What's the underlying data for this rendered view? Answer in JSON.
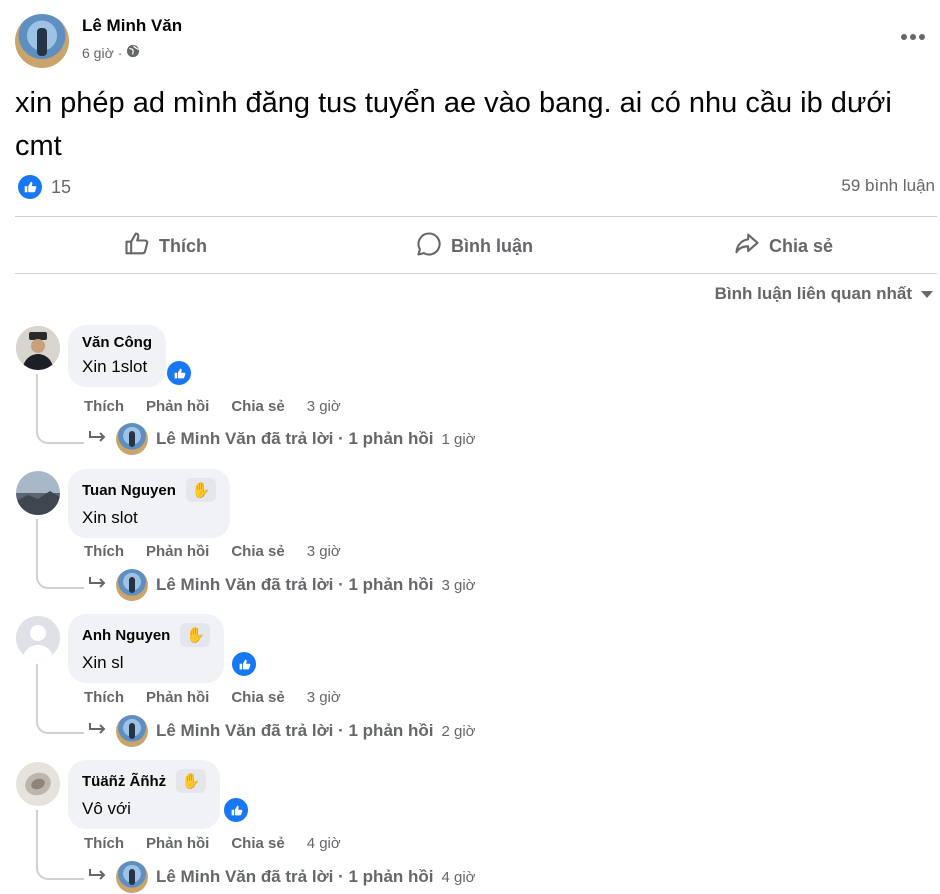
{
  "post": {
    "author": "Lê Minh Văn",
    "time": "6 giờ",
    "text": "xin phép ad mình đăng tus tuyển ae vào bang. ai có nhu cầu ib dưới cmt",
    "reaction_count": "15",
    "comment_count": "59 bình luận"
  },
  "actions": {
    "like": "Thích",
    "comment": "Bình luận",
    "share": "Chia sẻ"
  },
  "sort_label": "Bình luận liên quan nhất",
  "comment_actions": {
    "like": "Thích",
    "reply": "Phản hồi",
    "share": "Chia sẻ"
  },
  "comments": [
    {
      "name": "Văn Công",
      "text": "Xin 1slot",
      "time": "3 giờ",
      "reply_by": "Lê Minh Văn đã trả lời · 1 phản hồi",
      "reply_time": "1 giờ"
    },
    {
      "name": "Tuan Nguyen",
      "text": "Xin slot",
      "time": "3 giờ",
      "reply_by": "Lê Minh Văn đã trả lời · 1 phản hồi",
      "reply_time": "3 giờ"
    },
    {
      "name": "Anh Nguyen",
      "text": "Xin sl",
      "time": "3 giờ",
      "reply_by": "Lê Minh Văn đã trả lời · 1 phản hồi",
      "reply_time": "2 giờ"
    },
    {
      "name": "Tüäñż Ãñhż",
      "text": "Vô với",
      "time": "4 giờ",
      "reply_by": "Lê Minh Văn đã trả lời · 1 phản hồi",
      "reply_time": "4 giờ"
    }
  ],
  "colors": {
    "brand_blue": "#1877f2",
    "secondary_text": "#65676b",
    "bubble_bg": "#f0f2f5"
  }
}
